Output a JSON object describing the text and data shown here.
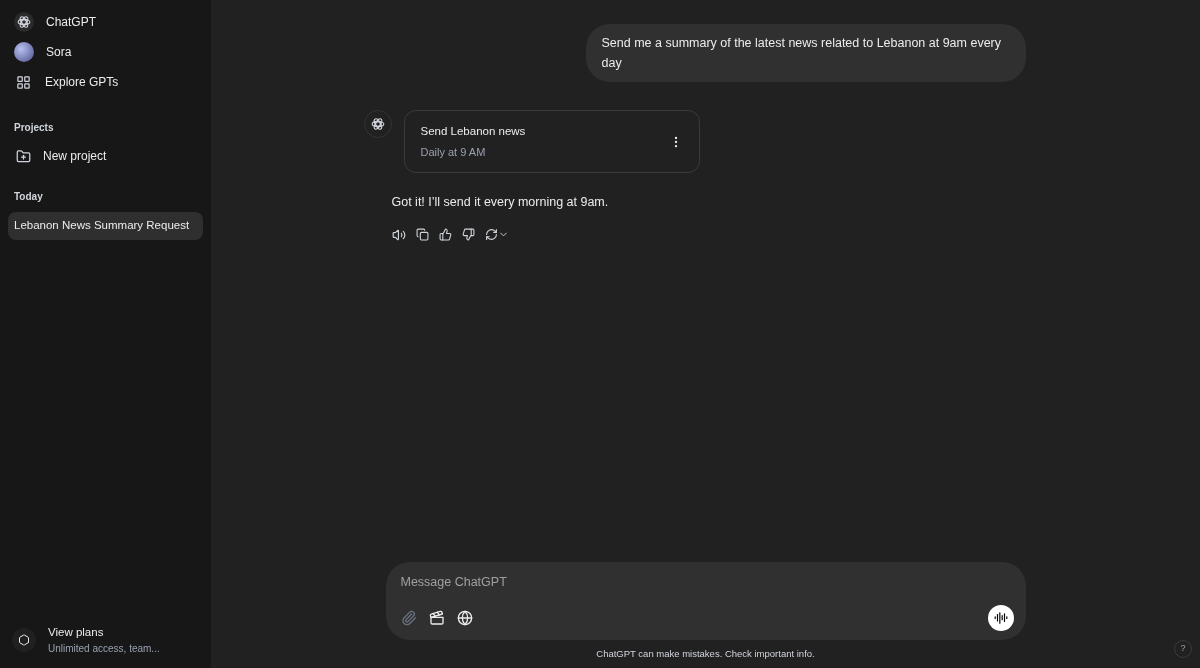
{
  "sidebar": {
    "nav": [
      {
        "kind": "logo",
        "label": "ChatGPT"
      },
      {
        "kind": "avatar",
        "label": "Sora"
      },
      {
        "kind": "grid",
        "label": "Explore GPTs"
      }
    ],
    "projects": {
      "heading": "Projects",
      "new_project": "New project"
    },
    "history": [
      {
        "heading": "Today",
        "chats": [
          {
            "title": "Lebanon News Summary Request",
            "selected": true
          }
        ]
      }
    ],
    "plans": {
      "title": "View plans",
      "subtitle": "Unlimited access, team..."
    }
  },
  "conversation": {
    "user_message": "Send me a summary of the latest news related to Lebanon at 9am every day",
    "task": {
      "title": "Send Lebanon news",
      "schedule": "Daily at 9 AM"
    },
    "reply": "Got it! I’ll send it every morning at 9am."
  },
  "composer": {
    "placeholder": "Message ChatGPT"
  },
  "disclaimer": "ChatGPT can make mistakes. Check important info.",
  "help": "?"
}
